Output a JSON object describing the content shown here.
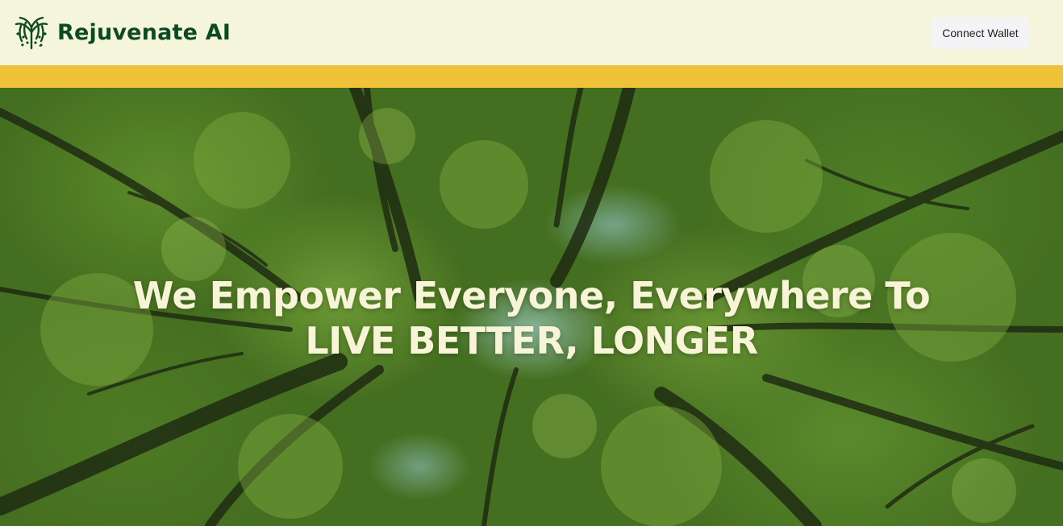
{
  "colors": {
    "header_bg": "#f5f5dc",
    "brand_green": "#0d4a22",
    "accent_yellow": "#efc23a",
    "headline_text": "#f7f4d8"
  },
  "header": {
    "logo_icon": "tree-logo-icon",
    "brand_name": "Rejuvenate AI",
    "connect_wallet_label": "Connect Wallet"
  },
  "hero": {
    "headline_line1": "We Empower Everyone, Everywhere To",
    "headline_line2": "LIVE BETTER, LONGER"
  }
}
